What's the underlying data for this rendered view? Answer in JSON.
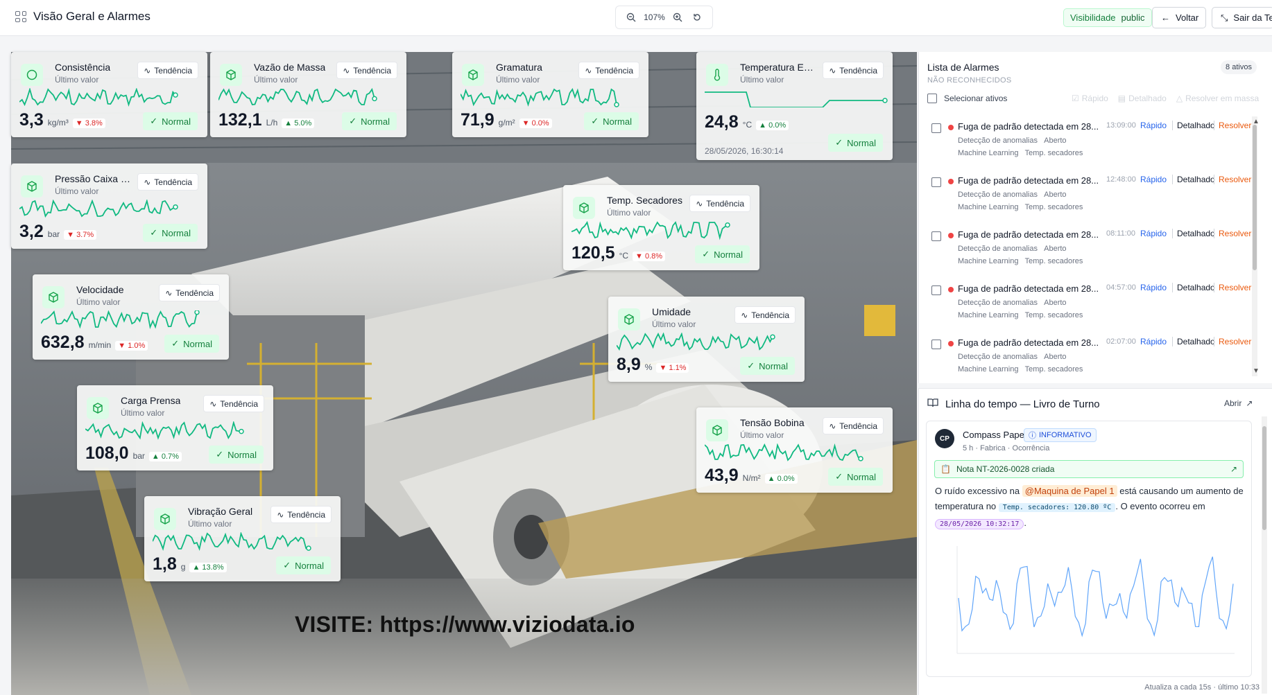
{
  "topbar": {
    "title": "Visão Geral e Alarmes",
    "zoom": "107%",
    "visibility_label": "Visibilidade",
    "visibility_value": "public",
    "back_label": "Voltar",
    "exit_label": "Sair da Te"
  },
  "scene": {
    "watermark": "VISITE: https://www.viziodata.io"
  },
  "kpi_cards": [
    {
      "name": "Consistência",
      "subtitle": "Último valor",
      "trend_label": "Tendência",
      "value": "3,3",
      "unit": "kg/m³",
      "change": "3.8%",
      "direction": "down",
      "status": "Normal",
      "icon": "circle-icon"
    },
    {
      "name": "Vazão de Massa",
      "subtitle": "Último valor",
      "trend_label": "Tendência",
      "value": "132,1",
      "unit": "L/h",
      "change": "5.0%",
      "direction": "up",
      "status": "Normal",
      "icon": "box-icon"
    },
    {
      "name": "Gramatura",
      "subtitle": "Último valor",
      "trend_label": "Tendência",
      "value": "71,9",
      "unit": "g/m²",
      "change": "0.0%",
      "direction": "down",
      "status": "Normal",
      "icon": "box-icon"
    },
    {
      "name": "Temperatura Externa",
      "subtitle": "Último valor",
      "trend_label": "Tendência",
      "value": "24,8",
      "unit": "°C",
      "change": "0.0%",
      "direction": "up",
      "status": "Normal",
      "icon": "thermometer-icon",
      "timestamp": "28/05/2026, 16:30:14"
    },
    {
      "name": "Pressão Caixa E...",
      "subtitle": "Último valor",
      "trend_label": "Tendência",
      "value": "3,2",
      "unit": "bar",
      "change": "3.7%",
      "direction": "down",
      "status": "Normal",
      "icon": "box-icon"
    },
    {
      "name": "Temp. Secadores",
      "subtitle": "Último valor",
      "trend_label": "Tendência",
      "value": "120,5",
      "unit": "°C",
      "change": "0.8%",
      "direction": "down",
      "status": "Normal",
      "icon": "box-icon"
    },
    {
      "name": "Velocidade",
      "subtitle": "Último valor",
      "trend_label": "Tendência",
      "value": "632,8",
      "unit": "m/min",
      "change": "1.0%",
      "direction": "down",
      "status": "Normal",
      "icon": "box-icon"
    },
    {
      "name": "Umidade",
      "subtitle": "Último valor",
      "trend_label": "Tendência",
      "value": "8,9",
      "unit": "%",
      "change": "1.1%",
      "direction": "down",
      "status": "Normal",
      "icon": "box-icon"
    },
    {
      "name": "Carga Prensa",
      "subtitle": "Último valor",
      "trend_label": "Tendência",
      "value": "108,0",
      "unit": "bar",
      "change": "0.7%",
      "direction": "up",
      "status": "Normal",
      "icon": "box-icon"
    },
    {
      "name": "Tensão Bobina",
      "subtitle": "Último valor",
      "trend_label": "Tendência",
      "value": "43,9",
      "unit": "N/m²",
      "change": "0.0%",
      "direction": "up",
      "status": "Normal",
      "icon": "box-icon"
    },
    {
      "name": "Vibração Geral",
      "subtitle": "Último valor",
      "trend_label": "Tendência",
      "value": "1,8",
      "unit": "g",
      "change": "13.8%",
      "direction": "up",
      "status": "Normal",
      "icon": "box-icon"
    }
  ],
  "alarms": {
    "title": "Lista de Alarmes",
    "subtitle": "NÃO RECONHECIDOS",
    "count": "8 ativos",
    "select_label": "Selecionar ativos",
    "bulk_actions": [
      "Rápido",
      "Detalhado",
      "Resolver em massa"
    ],
    "items": [
      {
        "title": "Fuga de padrão detectada em 28...",
        "category": "Detecção de anomalias",
        "state": "Aberto",
        "source": "Machine Learning",
        "tag": "Temp. secadores",
        "time": "13:09:00",
        "a1": "Rápido",
        "a2": "Detalhado",
        "a3": "Resolver"
      },
      {
        "title": "Fuga de padrão detectada em 28...",
        "category": "Detecção de anomalias",
        "state": "Aberto",
        "source": "Machine Learning",
        "tag": "Temp. secadores",
        "time": "12:48:00",
        "a1": "Rápido",
        "a2": "Detalhado",
        "a3": "Resolver"
      },
      {
        "title": "Fuga de padrão detectada em 28...",
        "category": "Detecção de anomalias",
        "state": "Aberto",
        "source": "Machine Learning",
        "tag": "Temp. secadores",
        "time": "08:11:00",
        "a1": "Rápido",
        "a2": "Detalhado",
        "a3": "Resolver"
      },
      {
        "title": "Fuga de padrão detectada em 28...",
        "category": "Detecção de anomalias",
        "state": "Aberto",
        "source": "Machine Learning",
        "tag": "Temp. secadores",
        "time": "04:57:00",
        "a1": "Rápido",
        "a2": "Detalhado",
        "a3": "Resolver"
      },
      {
        "title": "Fuga de padrão detectada em 28...",
        "category": "Detecção de anomalias",
        "state": "Aberto",
        "source": "Machine Learning",
        "tag": "Temp. secadores",
        "time": "02:07:00",
        "a1": "Rápido",
        "a2": "Detalhado",
        "a3": "Resolver"
      }
    ]
  },
  "timeline": {
    "title": "Linha do tempo — Livro de Turno",
    "open_label": "Abrir",
    "post": {
      "avatar": "CP",
      "author": "Compass Paper",
      "tag": "INFORMATIVO",
      "meta": "5 h · Fabrica · Ocorrência",
      "note": "Nota NT-2026-0028 criada",
      "text_1": "O ruído excessivo na",
      "mention": "@Maquina de Papel 1",
      "text_2": "está causando um aumento de temperatura no",
      "chip_tag": "Temp. secadores: 120.80 ºC",
      "text_3": ". O evento ocorreu em",
      "chip_time": "28/05/2026 10:32:17",
      "text_4": "."
    },
    "footer": "Atualiza a cada 15s · último 10:33"
  },
  "colors": {
    "accent": "#10b981",
    "status_ok": "#15803d",
    "danger": "#dc2626",
    "link": "#2563eb",
    "resolve": "#ea580c"
  }
}
